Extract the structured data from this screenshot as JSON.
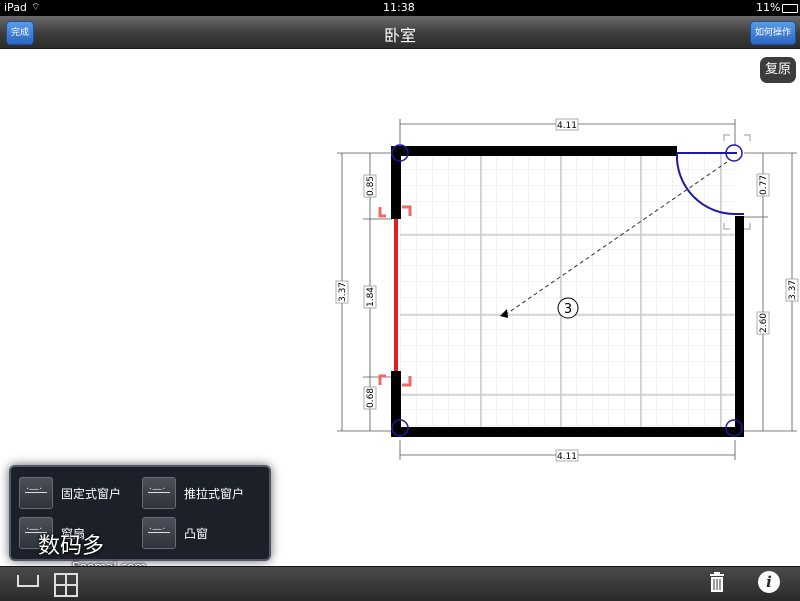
{
  "status": {
    "device": "iPad",
    "time": "11:38",
    "battery": "11%"
  },
  "nav": {
    "done_label": "完成",
    "title": "卧室",
    "help_label": "如何操作"
  },
  "restore_label": "复原",
  "plan": {
    "width_top": "4.11",
    "width_bottom": "4.11",
    "left_total": "3.37",
    "left_upper": "0.85",
    "left_window": "1.84",
    "left_lower": "0.68",
    "right_total": "3.37",
    "right_door": "0.77",
    "right_lower": "2.60",
    "room_number": "3"
  },
  "palette": {
    "items": [
      {
        "label": "固定式窗户"
      },
      {
        "label": "推拉式窗户"
      },
      {
        "label": "窗扇"
      },
      {
        "label": "凸窗"
      }
    ]
  },
  "watermark": {
    "text": "数码多",
    "sub": "Soomal.com"
  },
  "colors": {
    "accent": "#2b66c4",
    "window": "#e02020",
    "joint": "#1a1aa8"
  }
}
